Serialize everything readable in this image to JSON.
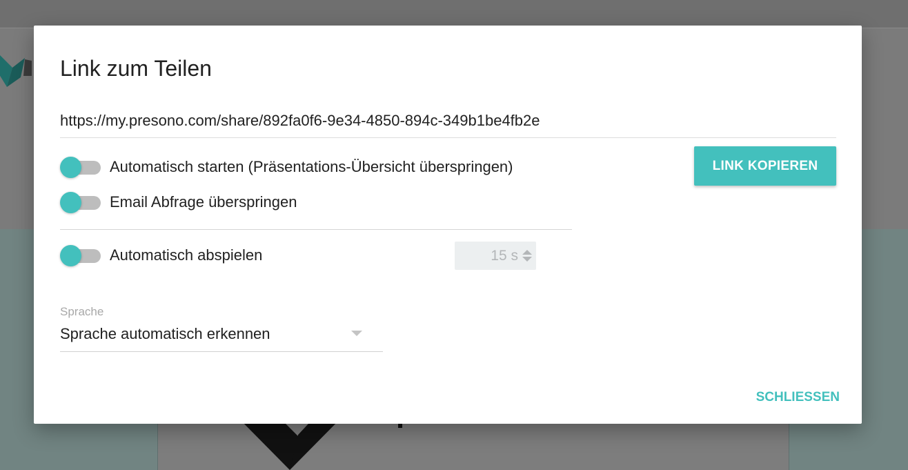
{
  "dialog": {
    "title": "Link zum Teilen",
    "share_url": "https://my.presono.com/share/892fa0f6-9e34-4850-894c-349b1be4fb2e",
    "copy_button_label": "LINK KOPIEREN",
    "close_button_label": "SCHLIESSEN"
  },
  "options": [
    {
      "label": "Automatisch starten (Präsentations-Übersicht überspringen)"
    },
    {
      "label": "Email Abfrage überspringen"
    },
    {
      "label": "Automatisch abspielen"
    }
  ],
  "autoplay": {
    "seconds": "15 s"
  },
  "language": {
    "label": "Sprache",
    "value": "Sprache automatisch erkennen"
  },
  "colors": {
    "accent": "#43c0bd",
    "track": "#bdbdbd"
  }
}
